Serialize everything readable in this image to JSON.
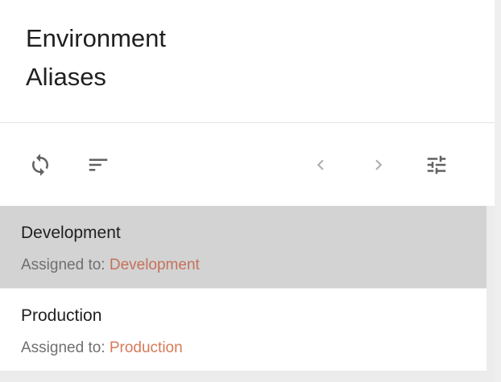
{
  "header": {
    "title_line1": "Environment",
    "title_line2": "Aliases"
  },
  "toolbar": {
    "refresh_icon": "refresh-icon",
    "sort_icon": "sort-icon",
    "prev_icon": "chevron-left-icon",
    "next_icon": "chevron-right-icon",
    "filter_icon": "tune-icon"
  },
  "list": {
    "items": [
      {
        "name": "Development",
        "assigned_prefix": "Assigned to: ",
        "assigned_value": "Development",
        "selected": true
      },
      {
        "name": "Production",
        "assigned_prefix": "Assigned to: ",
        "assigned_value": "Production",
        "selected": false
      }
    ]
  },
  "colors": {
    "link": "#d77b5a",
    "selected_bg": "#d3d3d3",
    "icon": "#616161",
    "icon_disabled": "#b0b0b0"
  }
}
